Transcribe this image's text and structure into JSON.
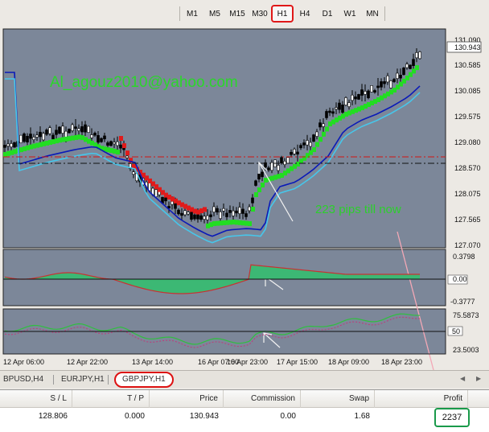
{
  "timeframes": [
    {
      "label": "M1",
      "active": false
    },
    {
      "label": "M5",
      "active": false
    },
    {
      "label": "M15",
      "active": false
    },
    {
      "label": "M30",
      "active": false
    },
    {
      "label": "H1",
      "active": true
    },
    {
      "label": "H4",
      "active": false
    },
    {
      "label": "D1",
      "active": false
    },
    {
      "label": "W1",
      "active": false
    },
    {
      "label": "MN",
      "active": false
    }
  ],
  "chart": {
    "watermark": "Al_agouz2010@yahoo.com",
    "annotation": "223 pips till now",
    "current_price": "130.943",
    "price_ticks": [
      "131.090",
      "130.585",
      "130.085",
      "129.575",
      "129.080",
      "128.570",
      "128.075",
      "127.565",
      "127.070"
    ],
    "time_ticks": [
      "12 Apr 06:00",
      "12 Apr 22:00",
      "13 Apr 14:00",
      "16 Apr 07:00",
      "16 Apr 23:00",
      "17 Apr 15:00",
      "18 Apr 09:00",
      "18 Apr 23:00"
    ],
    "osc1_ticks": [
      "0.3798",
      "0.00",
      "-0.3777"
    ],
    "osc2_ticks": [
      "75.5873",
      "50",
      "23.5003"
    ],
    "colors": {
      "background": "#7c8799",
      "candle": "#000000",
      "uptrend": "#22dd22",
      "downtrend": "#e01b1b",
      "blue_line": "#0a1ab8",
      "cyan_line": "#47c6ea",
      "histogram": "#3cb874",
      "signal": "#c93131",
      "rsi": "#2fbf3f",
      "rsi_signal": "#c0397a",
      "watermark": "#2bd62b",
      "annotation": "#2ccf2c"
    }
  },
  "symbol_tabs": [
    {
      "label": "BPUSD,H4",
      "active": false
    },
    {
      "label": "EURJPY,H1",
      "active": false
    },
    {
      "label": "GBPJPY,H1",
      "active": true
    }
  ],
  "terminal": {
    "headers": [
      "S / L",
      "T / P",
      "Price",
      "Commission",
      "Swap",
      "Profit"
    ],
    "row": {
      "sl": "128.806",
      "tp": "0.000",
      "price": "130.943",
      "commission": "0.00",
      "swap": "1.68",
      "profit": "2237"
    }
  },
  "icons": {
    "scroll_left": "triangle-left-icon",
    "scroll_right": "triangle-right-icon"
  }
}
